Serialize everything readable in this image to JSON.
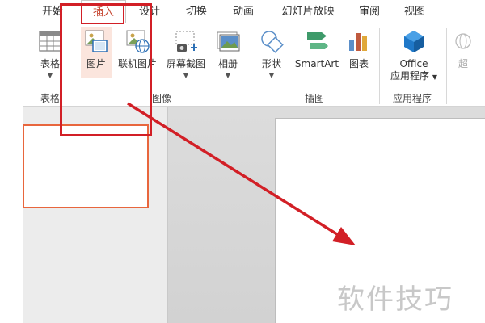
{
  "tabs": [
    {
      "label": "开始"
    },
    {
      "label": "插入"
    },
    {
      "label": "设计"
    },
    {
      "label": "切换"
    },
    {
      "label": "动画"
    },
    {
      "label": "幻灯片放映"
    },
    {
      "label": "审阅"
    },
    {
      "label": "视图"
    }
  ],
  "ribbon": {
    "table": {
      "label": "表格"
    },
    "picture": {
      "label": "图片"
    },
    "online_picture": {
      "label": "联机图片"
    },
    "screenshot": {
      "label": "屏幕截图"
    },
    "album": {
      "label": "相册"
    },
    "shapes": {
      "label": "形状"
    },
    "smartart": {
      "label": "SmartArt"
    },
    "chart": {
      "label": "图表"
    },
    "office_apps": {
      "line1": "Office",
      "line2": "应用程序"
    },
    "hyperlink_partial": {
      "label": "超"
    },
    "groups": {
      "tables": "表格",
      "images": "图像",
      "illustrations": "插图",
      "apps": "应用程序"
    }
  },
  "watermark": "软件技巧",
  "colors": {
    "active_tab_text": "#c5432d",
    "highlight": "#d21f26",
    "slide_border": "#e8663d"
  }
}
